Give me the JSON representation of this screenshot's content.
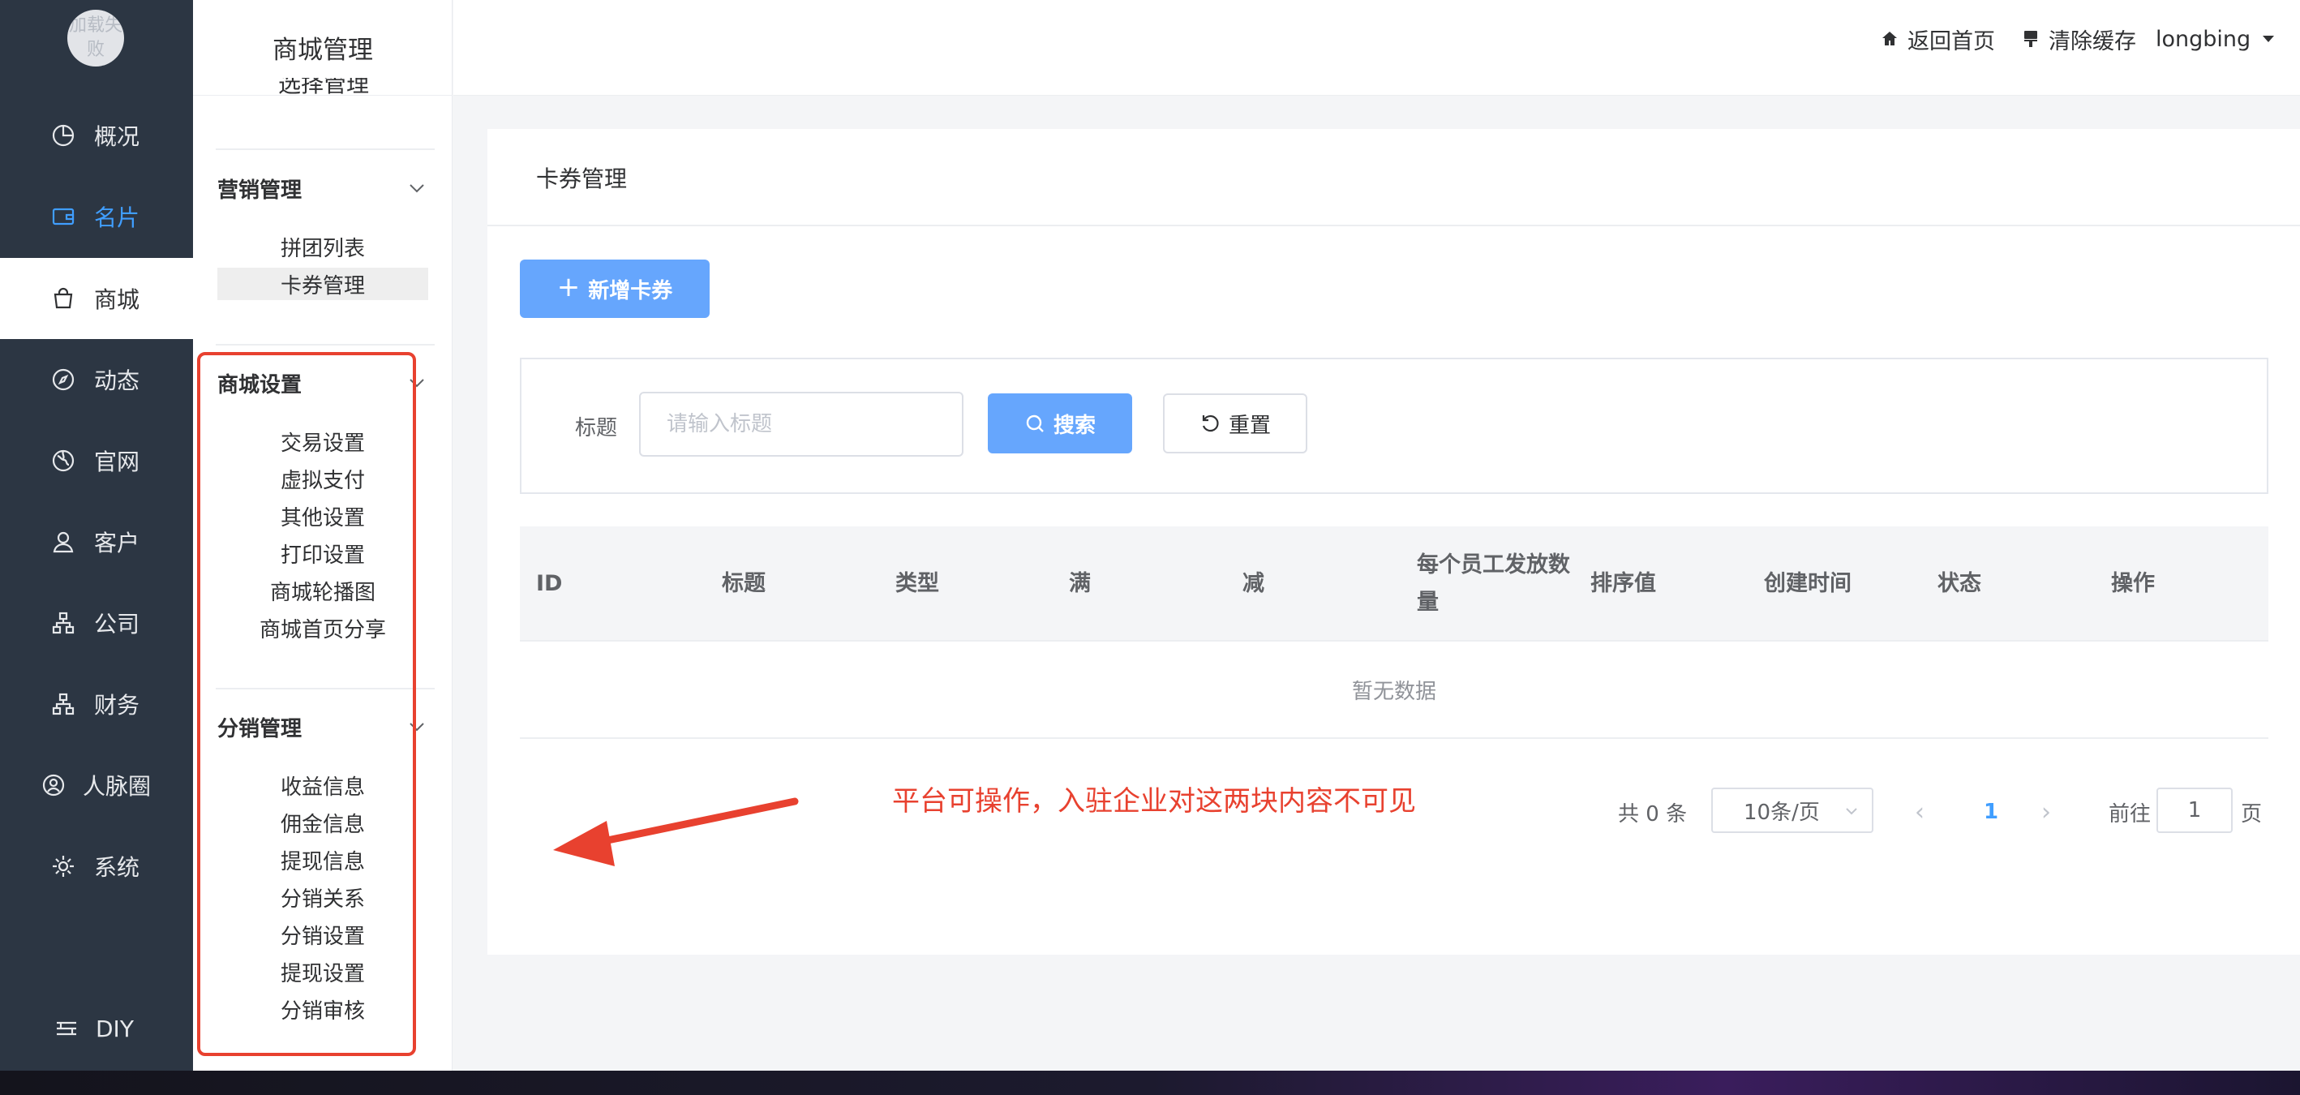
{
  "nav": {
    "avatar_text": "加载失败",
    "items": [
      {
        "label": "概况",
        "icon": "pie-chart-icon"
      },
      {
        "label": "名片",
        "icon": "wallet-icon"
      },
      {
        "label": "商城",
        "icon": "shopping-bag-icon"
      },
      {
        "label": "动态",
        "icon": "compass-icon"
      },
      {
        "label": "官网",
        "icon": "globe-icon"
      },
      {
        "label": "客户",
        "icon": "user-icon"
      },
      {
        "label": "公司",
        "icon": "org-chart-icon"
      },
      {
        "label": "财务",
        "icon": "org-chart-icon"
      },
      {
        "label": "人脉圈",
        "icon": "user-circle-icon"
      },
      {
        "label": "系统",
        "icon": "gear-icon"
      },
      {
        "label": "DIY",
        "icon": "layers-icon"
      }
    ]
  },
  "submenu": {
    "title": "商城管理",
    "cut_item": "选择管理",
    "groups": [
      {
        "title": "营销管理",
        "items": [
          "拼团列表",
          "卡券管理"
        ]
      },
      {
        "title": "商城设置",
        "items": [
          "交易设置",
          "虚拟支付",
          "其他设置",
          "打印设置",
          "商城轮播图",
          "商城首页分享"
        ]
      },
      {
        "title": "分销管理",
        "items": [
          "收益信息",
          "佣金信息",
          "提现信息",
          "分销关系",
          "分销设置",
          "提现设置",
          "分销审核"
        ]
      }
    ]
  },
  "header": {
    "home_label": "返回首页",
    "cache_label": "清除缓存",
    "user_label": "longbing"
  },
  "main": {
    "title": "卡券管理",
    "add_button": "新增卡券",
    "filter": {
      "label": "标题",
      "placeholder": "请输入标题",
      "search_button": "搜索",
      "reset_button": "重置"
    },
    "table": {
      "columns": [
        "ID",
        "标题",
        "类型",
        "满",
        "减",
        "每个员工发放数量",
        "排序值",
        "创建时间",
        "状态",
        "操作"
      ],
      "empty_text": "暂无数据"
    },
    "pagination": {
      "total_text": "共 0 条",
      "page_size": "10条/页",
      "current_page": "1",
      "goto_label": "前往",
      "goto_value": "1",
      "page_suffix": "页"
    }
  },
  "annotation": {
    "text": "平台可操作，入驻企业对这两块内容不可见",
    "color": "#e8412f"
  },
  "colors": {
    "accent": "#409eff",
    "nav_bg": "#2c3643"
  }
}
